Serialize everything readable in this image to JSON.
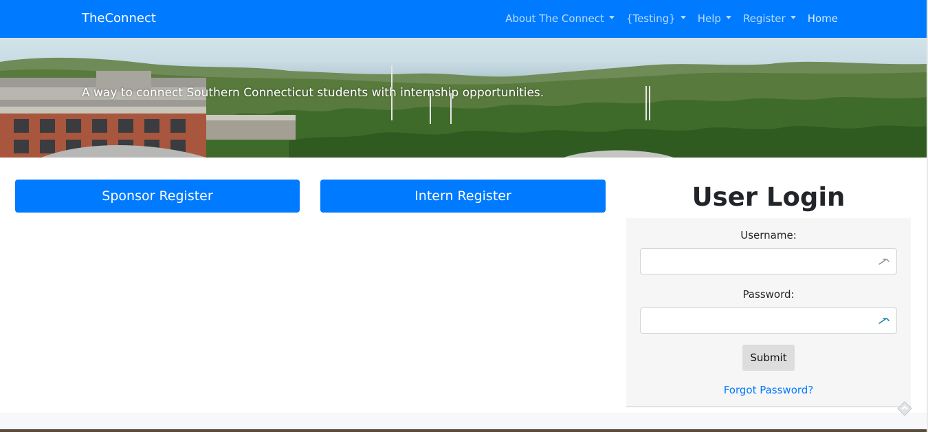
{
  "navbar": {
    "brand": "TheConnect",
    "items": [
      {
        "label": "About The Connect",
        "dropdown": true
      },
      {
        "label": "{Testing}",
        "dropdown": true
      },
      {
        "label": "Help",
        "dropdown": true
      },
      {
        "label": "Register",
        "dropdown": true
      },
      {
        "label": "Home",
        "dropdown": false
      }
    ],
    "background": "#007bff"
  },
  "hero": {
    "tagline": "A way to connect Southern Connecticut students with internship opportunities."
  },
  "actions": {
    "sponsor_register": "Sponsor Register",
    "intern_register": "Intern Register"
  },
  "login": {
    "title": "User Login",
    "username_label": "Username:",
    "username_value": "",
    "password_label": "Password:",
    "password_value": "",
    "submit_label": "Submit",
    "forgot_label": "Forgot Password?"
  },
  "colors": {
    "primary": "#007bff",
    "panel": "#f6f6f6",
    "submit_bg": "#dddddd"
  }
}
